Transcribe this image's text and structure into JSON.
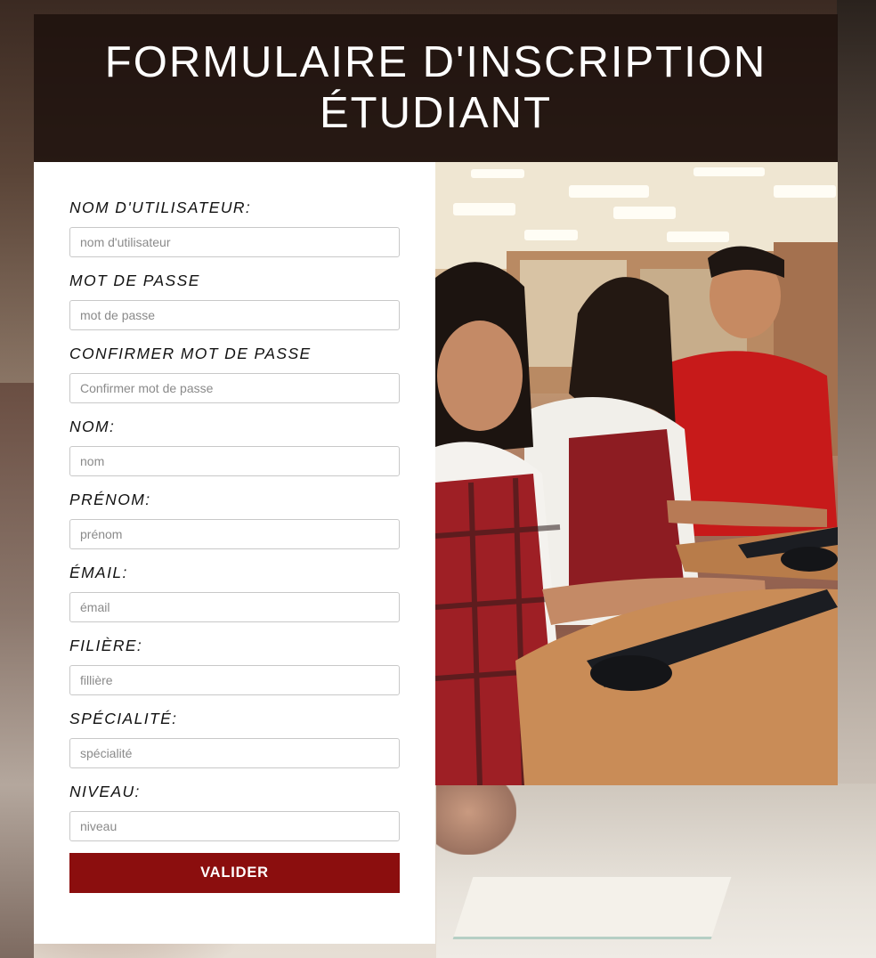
{
  "header": {
    "title": "FORMULAIRE D'INSCRIPTION ÉTUDIANT"
  },
  "form": {
    "fields": [
      {
        "label": "NOM D'UTILISATEUR:",
        "placeholder": "nom d'utilisateur",
        "value": ""
      },
      {
        "label": "MOT DE PASSE",
        "placeholder": "mot de passe",
        "value": ""
      },
      {
        "label": "CONFIRMER MOT DE PASSE",
        "placeholder": "Confirmer mot de passe",
        "value": ""
      },
      {
        "label": "NOM:",
        "placeholder": "nom",
        "value": ""
      },
      {
        "label": "PRÉNOM:",
        "placeholder": "prénom",
        "value": ""
      },
      {
        "label": "ÉMAIL:",
        "placeholder": "émail",
        "value": ""
      },
      {
        "label": "FILIÈRE:",
        "placeholder": "fillière",
        "value": ""
      },
      {
        "label": "SPÉCIALITÉ:",
        "placeholder": "spécialité",
        "value": ""
      },
      {
        "label": "NIVEAU:",
        "placeholder": "niveau",
        "value": ""
      }
    ],
    "submit_label": "VALIDER"
  },
  "colors": {
    "accent": "#8b0e0e",
    "header_bg": "#1c100c"
  }
}
